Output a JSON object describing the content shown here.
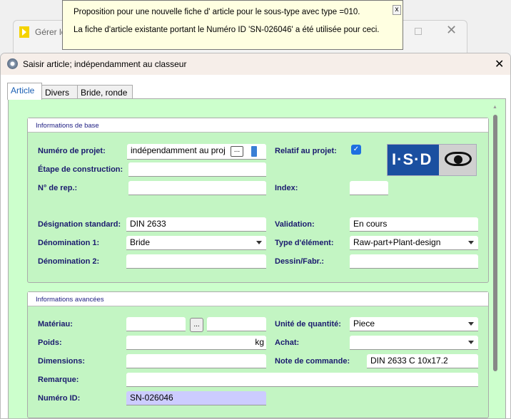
{
  "background_window": {
    "title": "Gérer le"
  },
  "tooltip": {
    "line1": "Proposition pour une nouvelle fiche d' article pour le sous-type avec type =010.",
    "line2": "La fiche d'article existante portant le Numéro ID 'SN-026046' a été utilisée pour ceci.",
    "close": "x"
  },
  "dialog": {
    "title": "Saisir article; indépendamment au classeur"
  },
  "tabs": [
    "Article",
    "Divers",
    "Bride, ronde"
  ],
  "basic": {
    "header": "Informations de base",
    "project_label": "Numéro de projet:",
    "project_value": "indépendamment au proj",
    "browse": "...",
    "stage_label": "Étape de construction:",
    "stage_value": "",
    "rep_label": "N° de rep.:",
    "rep_value": "",
    "relative_label": "Relatif au projet:",
    "relative_checked": true,
    "index_label": "Index:",
    "index_value": "",
    "std_label": "Désignation standard:",
    "std_value": "DIN 2633",
    "validation_label": "Validation:",
    "validation_value": "En cours",
    "name1_label": "Dénomination 1:",
    "name1_value": "Bride",
    "type_label": "Type d'élément:",
    "type_value": "Raw-part+Plant-design",
    "name2_label": "Dénomination 2:",
    "name2_value": "",
    "drawing_label": "Dessin/Fabr.:",
    "drawing_value": "",
    "logo_text": "I·S·D"
  },
  "advanced": {
    "header": "Informations avancées",
    "material_label": "Matériau:",
    "material_browse": "...",
    "unit_label": "Unité de quantité:",
    "unit_value": "Piece",
    "weight_label": "Poids:",
    "weight_unit": "kg",
    "purchase_label": "Achat:",
    "purchase_value": "",
    "dimensions_label": "Dimensions:",
    "order_note_label": "Note de commande:",
    "order_note_value": "DIN 2633 C 10x17.2",
    "remark_label": "Remarque:",
    "id_label": "Numéro ID:",
    "id_value": "SN-026046"
  }
}
